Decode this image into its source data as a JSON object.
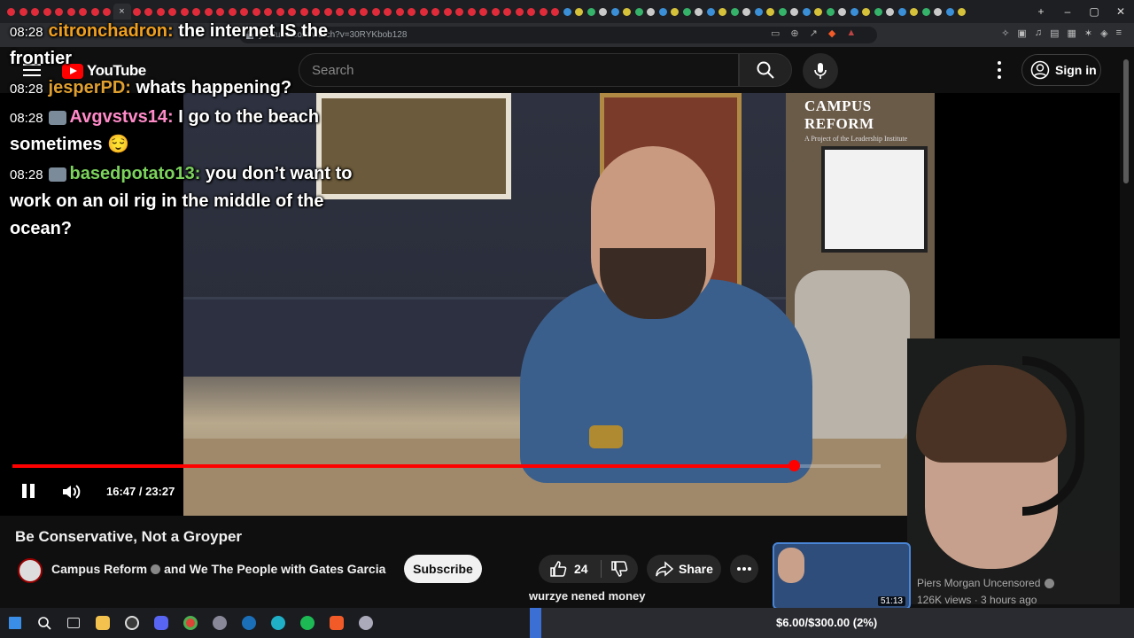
{
  "browser": {
    "active_tab_close": "×",
    "url": "youtube.com/watch?v=30RYKbob128",
    "window_controls": [
      "–",
      "▢",
      "✕"
    ],
    "new_tab": "+"
  },
  "youtube": {
    "logo_text": "YouTube",
    "search_placeholder": "Search",
    "sign_in": "Sign in"
  },
  "chat": [
    {
      "time": "08:28",
      "user": "citronchadron:",
      "text": "the internet IS the frontier",
      "color": "#f0a020"
    },
    {
      "time": "08:28",
      "user": "jesperPD:",
      "text": "whats happening?",
      "color": "#e0a030"
    },
    {
      "time": "08:28",
      "user": "Avgvstvs14:",
      "text": "I go to the beach sometimes 😌",
      "color": "#ff8ac8"
    },
    {
      "time": "08:28",
      "user": "basedpotato13:",
      "text": "you don’t want to work on an oil rig in the middle of the ocean?",
      "color": "#7bd35c"
    }
  ],
  "video": {
    "watermark_name": "CAMPUS REFORM",
    "watermark_sub": "A Project of the Leadership Institute",
    "current_time": "16:47",
    "duration": "23:27",
    "time_display": "16:47 / 23:27",
    "progress": 0.9
  },
  "details": {
    "title": "Be Conservative, Not a Groyper",
    "channel": "Campus Reform",
    "collab": "and We The People with Gates Garcia",
    "subscribe": "Subscribe",
    "likes": "24",
    "share": "Share"
  },
  "overlay_caption": "wurzye nened money",
  "recommended": {
    "channel": "Piers Morgan Uncensored",
    "meta": "126K views · 3 hours ago",
    "duration": "51:13"
  },
  "taskbar": {
    "goal_text": "$6.00/$300.00 (2%)",
    "goal_progress": 0.02
  },
  "colors": {
    "accent_red": "#ff0000",
    "background": "#0f0f0f"
  }
}
